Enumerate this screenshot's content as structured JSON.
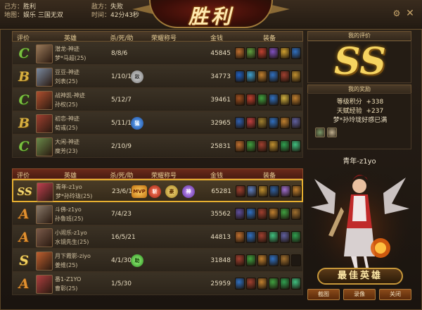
{
  "header": {
    "our_side_label": "己方：",
    "our_side_result": "胜利",
    "enemy_side_label": "敌方：",
    "enemy_side_result": "失败",
    "map_label": "地图：",
    "map_value": "娱乐 三国无双",
    "time_label": "时间：",
    "time_value": "42分43秒",
    "banner_title": "胜利"
  },
  "columns": {
    "grade": "评价",
    "hero": "英雄",
    "kda": "杀/死/助",
    "honor": "荣耀称号",
    "gold": "金钱",
    "equip": "装备"
  },
  "team_enemy": [
    {
      "grade": "C",
      "hero": "潜龙-神迹",
      "player": "梦*马超(25)",
      "kda": "8/8/6",
      "gold": "45845",
      "avatar": "#9a7a5a",
      "honors": [],
      "equip": [
        "#c07030",
        "#60a040",
        "#c04030",
        "#8050c0",
        "#d0a030",
        "#3070c0"
      ]
    },
    {
      "grade": "B",
      "hero": "豆豆-神迹",
      "player": "刘表(25)",
      "kda": "1/10/14",
      "gold": "34773",
      "avatar": "#7a8aa0",
      "honors": [
        {
          "t": "grey",
          "label": "敌"
        }
      ],
      "equip": [
        "#2060c0",
        "#40a0d0",
        "#c08030",
        "#3070c0",
        "#a04030",
        "#c09030"
      ]
    },
    {
      "grade": "C",
      "hero": "战神凯-神迹",
      "player": "孙权(25)",
      "kda": "5/12/7",
      "gold": "39461",
      "avatar": "#b05030",
      "honors": [],
      "equip": [
        "#a05020",
        "#c04030",
        "#40a040",
        "#3070c0",
        "#d0b040",
        "#c08030"
      ]
    },
    {
      "grade": "B",
      "hero": "初恋-神迹",
      "player": "荀彧(25)",
      "kda": "5/11/12",
      "gold": "32965",
      "avatar": "#a04030",
      "honors": [
        {
          "t": "blue",
          "label": "猛"
        }
      ],
      "equip": [
        "#3060b0",
        "#c04040",
        "#a08030",
        "#3070c0",
        "#c08030",
        "#6060a0"
      ]
    },
    {
      "grade": "C",
      "hero": "大闲-神迹",
      "player": "糜芳(23)",
      "kda": "2/10/9",
      "gold": "25831",
      "avatar": "#6a8a4a",
      "honors": [],
      "equip": [
        "#c07030",
        "#40a040",
        "#a04030",
        "#c09030",
        "#30a050",
        "#40c080"
      ]
    }
  ],
  "team_ours": [
    {
      "grade": "SS",
      "hero": "青年-z1yo",
      "player": "梦*孙玲珑(25)",
      "kda": "23/6/10",
      "gold": "65281",
      "avatar": "#c04050",
      "highlight": true,
      "honors": [
        {
          "t": "mvp",
          "label": "MVP"
        },
        {
          "t": "red",
          "label": "斩"
        },
        {
          "t": "gold",
          "label": "豪"
        },
        {
          "t": "purple",
          "label": "神"
        }
      ],
      "equip": [
        "#a04030",
        "#6080c0",
        "#c09030",
        "#3060a0",
        "#a070d0",
        "#c08030"
      ]
    },
    {
      "grade": "A",
      "hero": "斗佛-z1yo",
      "player": "孙鲁班(25)",
      "kda": "7/4/23",
      "gold": "35562",
      "avatar": "#8a7a6a",
      "honors": [],
      "equip": [
        "#6050a0",
        "#3070c0",
        "#a04030",
        "#c08030",
        "#40a040",
        "#a07030"
      ]
    },
    {
      "grade": "A",
      "hero": "小闹乐-z1yo",
      "player": "水镜先生(25)",
      "kda": "16/5/21",
      "gold": "44813",
      "avatar": "#7a5a4a",
      "honors": [],
      "equip": [
        "#c07030",
        "#3070c0",
        "#a04030",
        "#40c080",
        "#6060a0",
        "#30a050"
      ]
    },
    {
      "grade": "S",
      "hero": "月下霞影-ziyo",
      "player": "姜维(25)",
      "kda": "4/1/30",
      "gold": "31848",
      "avatar": "#c06030",
      "honors": [
        {
          "t": "green",
          "label": "助"
        }
      ],
      "equip": [
        "#a04030",
        "#40a040",
        "#c08030",
        "#3070c0",
        "#a07030",
        ""
      ]
    },
    {
      "grade": "A",
      "hero": "番1-Z1YO",
      "player": "曹彰(25)",
      "kda": "1/5/30",
      "gold": "25959",
      "avatar": "#b04040",
      "honors": [],
      "equip": [
        "#3070c0",
        "#a04030",
        "#c08030",
        "#40a040",
        "#30a050",
        "#40c080"
      ]
    }
  ],
  "right_panel": {
    "my_rating_title": "我的评价",
    "my_rating_grade": "SS",
    "my_reward_title": "我的奖励",
    "level_score_label": "等级积分",
    "level_score_value": "+338",
    "talent_exp_label": "天赋经验",
    "talent_exp_value": "+237",
    "favor_text": "梦*孙玲珑好感已满",
    "reward_items": [
      "#7a9a6a",
      "#c0b090"
    ],
    "player_name": "青年-z1yo",
    "best_hero_label": "最佳英雄",
    "buttons": {
      "screenshot": "截图",
      "record": "录像",
      "close": "关闭"
    }
  }
}
